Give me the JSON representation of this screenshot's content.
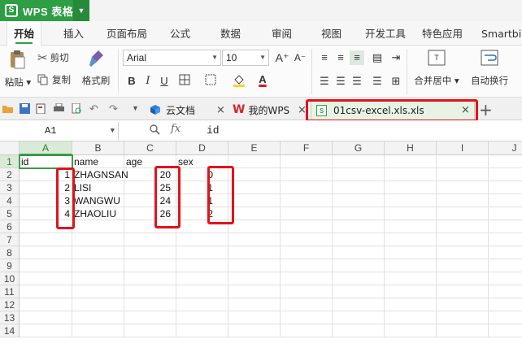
{
  "app": {
    "title": "WPS 表格",
    "logo": "S"
  },
  "ribbon_tabs": [
    "开始",
    "插入",
    "页面布局",
    "公式",
    "数据",
    "审阅",
    "视图",
    "开发工具",
    "特色应用",
    "Smartbi"
  ],
  "ribbon": {
    "paste": "粘贴",
    "cut": "剪切",
    "copy": "复制",
    "format_painter": "格式刷",
    "font_name": "Arial",
    "font_size": "10",
    "merge_center": "合并居中",
    "wrap_text": "自动换行"
  },
  "doc_tabs": [
    {
      "label": "云文档"
    },
    {
      "label": "我的WPS"
    },
    {
      "label": "01csv-excel.xls.xls"
    }
  ],
  "formula_bar": {
    "cell_ref": "A1",
    "fx": "fx",
    "value": "id"
  },
  "columns": [
    "A",
    "B",
    "C",
    "D",
    "E",
    "F",
    "G",
    "H",
    "I",
    "J"
  ],
  "rows": [
    "1",
    "2",
    "3",
    "4",
    "5",
    "6",
    "7",
    "8",
    "9",
    "10",
    "11",
    "12",
    "13",
    "14"
  ],
  "sheet": {
    "headers": [
      "id",
      "name",
      "age",
      "sex"
    ],
    "data": [
      [
        "1",
        "ZHAGNSAN",
        "20",
        "0"
      ],
      [
        "2",
        "LISI",
        "25",
        "1"
      ],
      [
        "3",
        "WANGWU",
        "24",
        "1"
      ],
      [
        "4",
        "ZHAOLIU",
        "26",
        "2"
      ]
    ]
  },
  "colors": {
    "brand_green": "#2e9e44",
    "highlight_red": "#e3121a",
    "active_cell": "#3a9a4a"
  }
}
